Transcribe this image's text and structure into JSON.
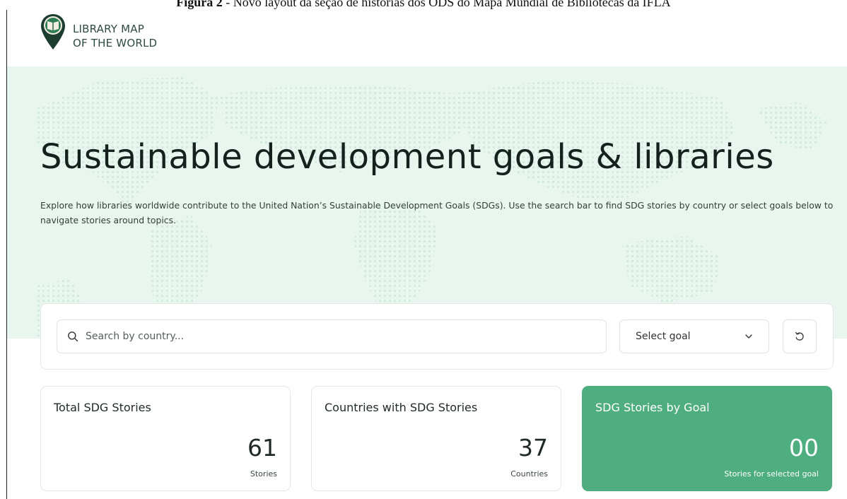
{
  "caption": {
    "label": "Figura 2",
    "text": " - Novo layout da seção de histórias dos ODS do Mapa Mundial de Bibliotecas da IFLA"
  },
  "logo": {
    "line1": "LIBRARY MAP",
    "line2": "OF THE WORLD",
    "icon": "map-pin-book-icon"
  },
  "hero": {
    "title": "Sustainable development goals & libraries",
    "description": "Explore how libraries worldwide contribute to the United Nation’s Sustainable Development Goals (SDGs). Use the search bar to find SDG stories by country or select goals below to navigate stories around topics."
  },
  "search": {
    "placeholder": "Search by country...",
    "value": "",
    "icon": "search-icon"
  },
  "goal_select": {
    "selected": "Select goal",
    "icon": "chevron-down-icon"
  },
  "reset": {
    "icon": "reset-icon"
  },
  "stats": [
    {
      "title": "Total SDG Stories",
      "value": "61",
      "unit": "Stories"
    },
    {
      "title": "Countries with SDG Stories",
      "value": "37",
      "unit": "Countries"
    },
    {
      "title": "SDG Stories by Goal",
      "value": "00",
      "unit": "Stories for selected goal"
    }
  ],
  "colors": {
    "accent": "#4fae7f",
    "hero_bg": "#e8f6ef",
    "logo_green": "#2f7d55",
    "logo_dark": "#1e3d31"
  }
}
